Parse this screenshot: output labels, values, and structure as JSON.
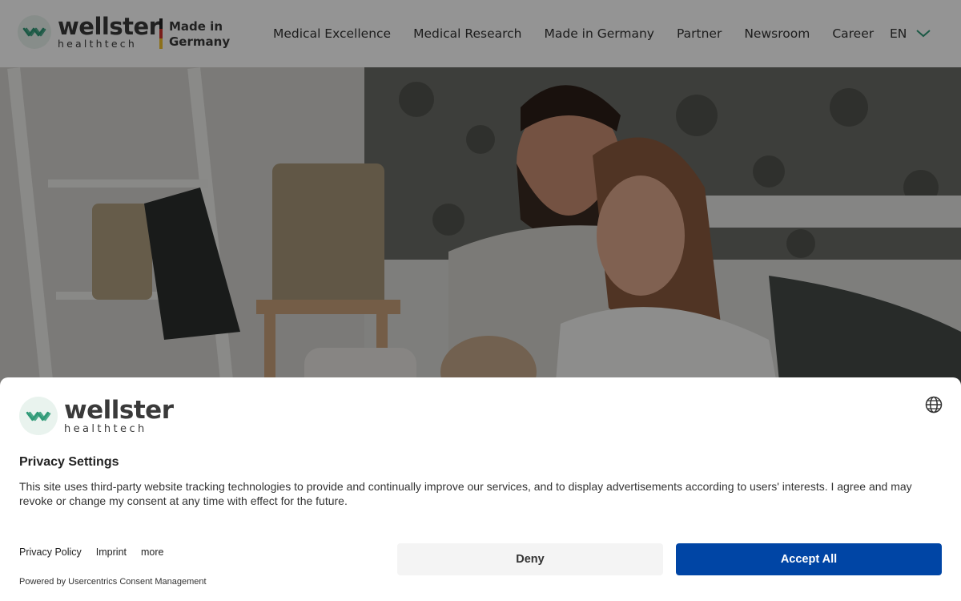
{
  "header": {
    "logo": {
      "word": "wellster",
      "sub": "healthtech"
    },
    "made_in": {
      "line1": "Made in",
      "line2": "Germany"
    },
    "nav": [
      "Medical Excellence",
      "Medical Research",
      "Made in Germany",
      "Partner",
      "Newsroom",
      "Career"
    ],
    "language": {
      "label": "EN",
      "icon": "chevron-down-icon"
    }
  },
  "colors": {
    "brand_green": "#2f9a77",
    "accept_blue": "#0045a5",
    "flag_black": "#222222",
    "flag_red": "#d0342c",
    "flag_gold": "#f2c230"
  },
  "hero": {
    "image": "family-photo"
  },
  "consent": {
    "logo": {
      "word": "wellster",
      "sub": "healthtech"
    },
    "title": "Privacy Settings",
    "text": "This site uses third-party website tracking technologies to provide and continually improve our services, and to display advertisements according to users' interests. I agree and may revoke or change my consent at any time with effect for the future.",
    "links": [
      "Privacy Policy",
      "Imprint",
      "more"
    ],
    "powered_by": "Powered by Usercentrics Consent Management",
    "deny_label": "Deny",
    "accept_label": "Accept All"
  }
}
